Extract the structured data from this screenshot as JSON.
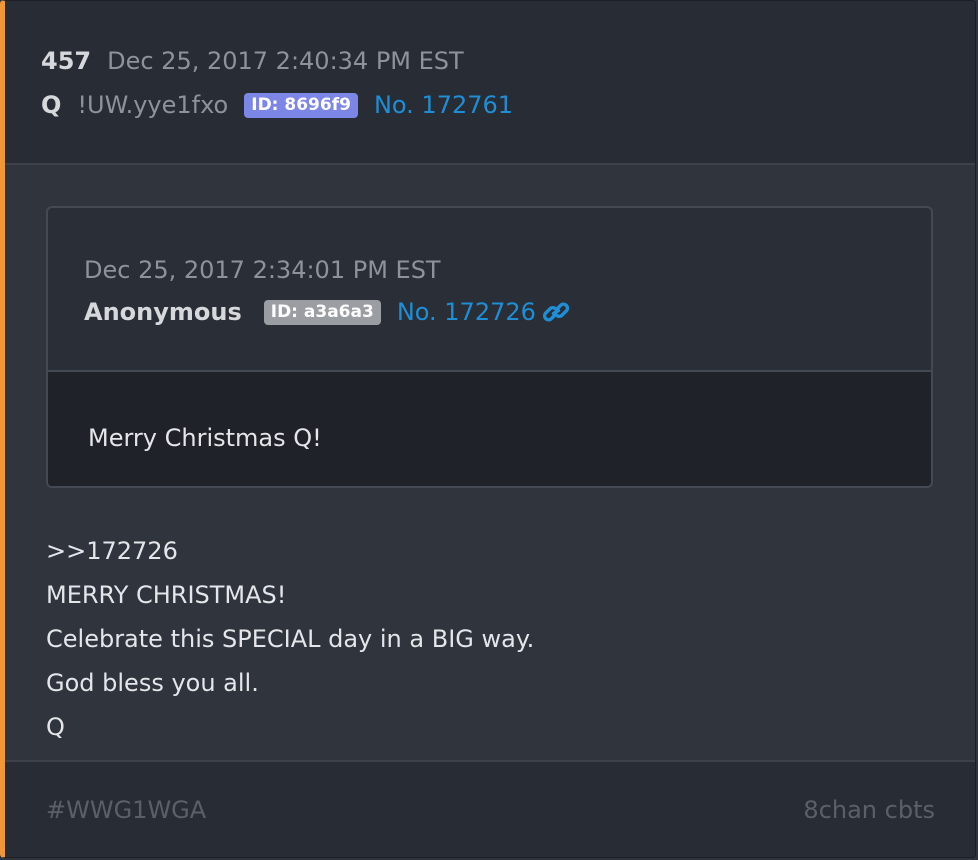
{
  "post": {
    "number": "457",
    "date": "Dec 25, 2017 2:40:34 PM EST",
    "author": "Q",
    "tripcode": "!UW.yye1fxo",
    "id_badge": "ID: 8696f9",
    "post_no": "No. 172761"
  },
  "quoted": {
    "date": "Dec 25, 2017 2:34:01 PM EST",
    "author": "Anonymous",
    "id_badge": "ID: a3a6a3",
    "post_no": "No. 172726",
    "text": "Merry Christmas Q!"
  },
  "body": {
    "lines": [
      ">>172726",
      "MERRY CHRISTMAS!",
      "Celebrate this SPECIAL day in a BIG way.",
      "God bless you all.",
      "Q"
    ]
  },
  "footer": {
    "hashtag": "#WWG1WGA",
    "source": "8chan cbts"
  },
  "icons": {
    "link": "link-icon"
  },
  "colors": {
    "accent_bar": "#f0973a",
    "id_badge_q": "#7c86e6",
    "id_badge_anon": "#9a9ea3",
    "link": "#1e8fd6"
  }
}
